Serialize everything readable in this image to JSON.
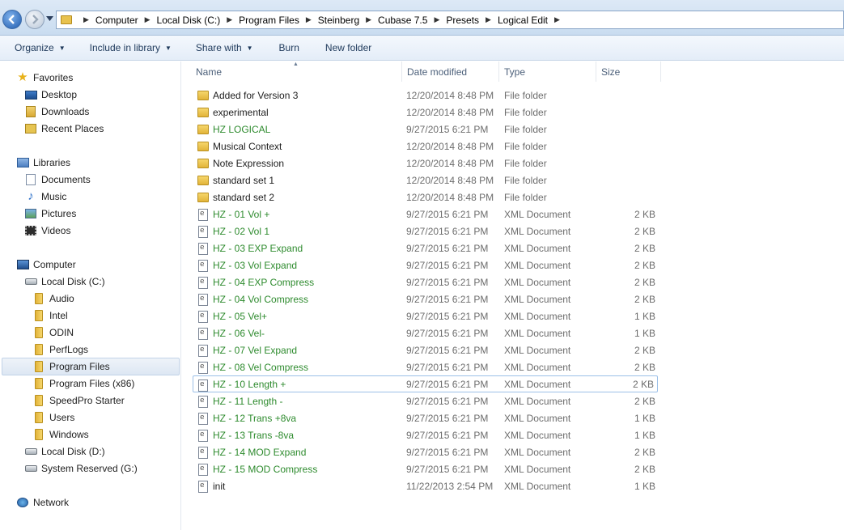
{
  "address": {
    "crumbs": [
      "Computer",
      "Local Disk (C:)",
      "Program Files",
      "Steinberg",
      "Cubase 7.5",
      "Presets",
      "Logical Edit"
    ]
  },
  "toolbar": {
    "organize": "Organize",
    "include_in_library": "Include in library",
    "share_with": "Share with",
    "burn": "Burn",
    "new_folder": "New folder"
  },
  "nav": {
    "favorites": "Favorites",
    "desktop": "Desktop",
    "downloads": "Downloads",
    "recent_places": "Recent Places",
    "libraries": "Libraries",
    "documents": "Documents",
    "music": "Music",
    "pictures": "Pictures",
    "videos": "Videos",
    "computer": "Computer",
    "local_c": "Local Disk (C:)",
    "audio": "Audio",
    "intel": "Intel",
    "odin": "ODIN",
    "perflogs": "PerfLogs",
    "program_files": "Program Files",
    "program_files_x86": "Program Files (x86)",
    "speedpro": "SpeedPro Starter",
    "users": "Users",
    "windows": "Windows",
    "local_d": "Local Disk (D:)",
    "system_reserved": "System Reserved (G:)",
    "network": "Network"
  },
  "columns": {
    "name": "Name",
    "date_modified": "Date modified",
    "type": "Type",
    "size": "Size"
  },
  "files": [
    {
      "name": "Added for Version 3",
      "date": "12/20/2014 8:48 PM",
      "type": "File folder",
      "size": "",
      "kind": "folder",
      "green": false
    },
    {
      "name": "experimental",
      "date": "12/20/2014 8:48 PM",
      "type": "File folder",
      "size": "",
      "kind": "folder",
      "green": false
    },
    {
      "name": "HZ LOGICAL",
      "date": "9/27/2015 6:21 PM",
      "type": "File folder",
      "size": "",
      "kind": "folder",
      "green": true
    },
    {
      "name": "Musical Context",
      "date": "12/20/2014 8:48 PM",
      "type": "File folder",
      "size": "",
      "kind": "folder",
      "green": false
    },
    {
      "name": "Note Expression",
      "date": "12/20/2014 8:48 PM",
      "type": "File folder",
      "size": "",
      "kind": "folder",
      "green": false
    },
    {
      "name": "standard set 1",
      "date": "12/20/2014 8:48 PM",
      "type": "File folder",
      "size": "",
      "kind": "folder",
      "green": false
    },
    {
      "name": "standard set 2",
      "date": "12/20/2014 8:48 PM",
      "type": "File folder",
      "size": "",
      "kind": "folder",
      "green": false
    },
    {
      "name": "HZ - 01 Vol +",
      "date": "9/27/2015 6:21 PM",
      "type": "XML Document",
      "size": "2 KB",
      "kind": "xml",
      "green": true
    },
    {
      "name": "HZ - 02 Vol 1",
      "date": "9/27/2015 6:21 PM",
      "type": "XML Document",
      "size": "2 KB",
      "kind": "xml",
      "green": true
    },
    {
      "name": "HZ - 03 EXP Expand",
      "date": "9/27/2015 6:21 PM",
      "type": "XML Document",
      "size": "2 KB",
      "kind": "xml",
      "green": true
    },
    {
      "name": "HZ - 03 Vol Expand",
      "date": "9/27/2015 6:21 PM",
      "type": "XML Document",
      "size": "2 KB",
      "kind": "xml",
      "green": true
    },
    {
      "name": "HZ - 04 EXP Compress",
      "date": "9/27/2015 6:21 PM",
      "type": "XML Document",
      "size": "2 KB",
      "kind": "xml",
      "green": true
    },
    {
      "name": "HZ - 04 Vol Compress",
      "date": "9/27/2015 6:21 PM",
      "type": "XML Document",
      "size": "2 KB",
      "kind": "xml",
      "green": true
    },
    {
      "name": "HZ - 05 Vel+",
      "date": "9/27/2015 6:21 PM",
      "type": "XML Document",
      "size": "1 KB",
      "kind": "xml",
      "green": true
    },
    {
      "name": "HZ - 06 Vel-",
      "date": "9/27/2015 6:21 PM",
      "type": "XML Document",
      "size": "1 KB",
      "kind": "xml",
      "green": true
    },
    {
      "name": "HZ - 07 Vel Expand",
      "date": "9/27/2015 6:21 PM",
      "type": "XML Document",
      "size": "2 KB",
      "kind": "xml",
      "green": true
    },
    {
      "name": "HZ - 08 Vel Compress",
      "date": "9/27/2015 6:21 PM",
      "type": "XML Document",
      "size": "2 KB",
      "kind": "xml",
      "green": true
    },
    {
      "name": "HZ - 10 Length +",
      "date": "9/27/2015 6:21 PM",
      "type": "XML Document",
      "size": "2 KB",
      "kind": "xml",
      "green": true,
      "focus": true
    },
    {
      "name": "HZ - 11 Length -",
      "date": "9/27/2015 6:21 PM",
      "type": "XML Document",
      "size": "2 KB",
      "kind": "xml",
      "green": true
    },
    {
      "name": "HZ - 12 Trans +8va",
      "date": "9/27/2015 6:21 PM",
      "type": "XML Document",
      "size": "1 KB",
      "kind": "xml",
      "green": true
    },
    {
      "name": "HZ - 13 Trans -8va",
      "date": "9/27/2015 6:21 PM",
      "type": "XML Document",
      "size": "1 KB",
      "kind": "xml",
      "green": true
    },
    {
      "name": "HZ - 14 MOD Expand",
      "date": "9/27/2015 6:21 PM",
      "type": "XML Document",
      "size": "2 KB",
      "kind": "xml",
      "green": true
    },
    {
      "name": "HZ - 15 MOD Compress",
      "date": "9/27/2015 6:21 PM",
      "type": "XML Document",
      "size": "2 KB",
      "kind": "xml",
      "green": true
    },
    {
      "name": "init",
      "date": "11/22/2013 2:54 PM",
      "type": "XML Document",
      "size": "1 KB",
      "kind": "xml",
      "green": false
    }
  ],
  "colors": {
    "highlight_green": "#2e8b2e",
    "toolbar_text": "#1e395b"
  }
}
